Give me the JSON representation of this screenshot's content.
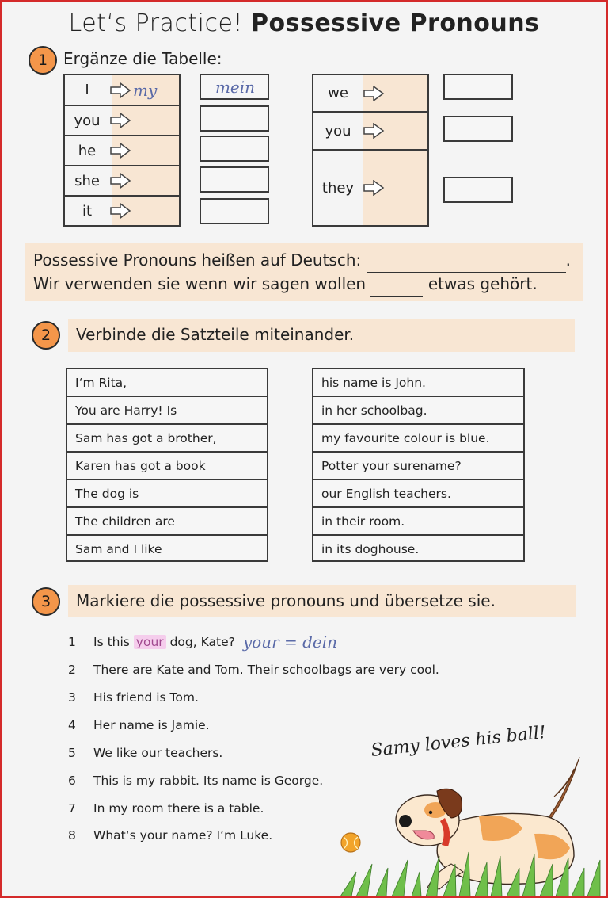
{
  "title": {
    "part1": "Let‘s Practice!",
    "part2": "Possessive Pronouns"
  },
  "section1": {
    "number": "1",
    "heading": "Ergänze die Tabelle:",
    "left_table": [
      {
        "pronoun": "I",
        "possessive": "my",
        "german": "mein"
      },
      {
        "pronoun": "you",
        "possessive": "",
        "german": ""
      },
      {
        "pronoun": "he",
        "possessive": "",
        "german": ""
      },
      {
        "pronoun": "she",
        "possessive": "",
        "german": ""
      },
      {
        "pronoun": "it",
        "possessive": "",
        "german": ""
      }
    ],
    "right_table": [
      {
        "pronoun": "we",
        "possessive": "",
        "german": ""
      },
      {
        "pronoun": "you",
        "possessive": "",
        "german": ""
      },
      {
        "pronoun": "they",
        "possessive": "",
        "german": ""
      }
    ],
    "fill_sentence_1": "Possessive Pronouns heißen auf Deutsch:",
    "fill_sentence_1_end": ".",
    "fill_sentence_2_start": "Wir verwenden sie wenn wir sagen wollen",
    "fill_sentence_2_end": "etwas gehört."
  },
  "section2": {
    "number": "2",
    "heading": "Verbinde die Satzteile miteinander.",
    "left_column": [
      "I‘m Rita,",
      "You are Harry! Is",
      "Sam has got a brother,",
      "Karen has got a book",
      "The dog is",
      "The children are",
      "Sam and I like"
    ],
    "right_column": [
      "his name is John.",
      "in her schoolbag.",
      "my favourite colour is blue.",
      "Potter your surename?",
      "our English teachers.",
      "in their room.",
      "in its doghouse."
    ]
  },
  "section3": {
    "number": "3",
    "heading": "Markiere die possessive pronouns und übersetze sie.",
    "sentences": [
      {
        "num": "1",
        "before": "Is this",
        "highlight": "your",
        "after": "dog, Kate?",
        "translation": "your = dein"
      },
      {
        "num": "2",
        "text": "There are Kate and Tom. Their schoolbags are very cool."
      },
      {
        "num": "3",
        "text": "His friend is Tom."
      },
      {
        "num": "4",
        "text": "Her name is Jamie."
      },
      {
        "num": "5",
        "text": "We like our teachers."
      },
      {
        "num": "6",
        "text": "This is my rabbit. Its name is George."
      },
      {
        "num": "7",
        "text": "In my room there is a table."
      },
      {
        "num": "8",
        "text": "What‘s your name? I‘m Luke."
      }
    ]
  },
  "illustration": {
    "caption": "Samy loves his ball!",
    "icon": "dog-with-ball-illustration"
  },
  "colors": {
    "border": "#d42a2a",
    "background": "#f4f4f4",
    "band": "#f8e6d3",
    "badge": "#f4964a",
    "handwriting": "#5a6aa8",
    "highlight": "#f5cdec"
  }
}
